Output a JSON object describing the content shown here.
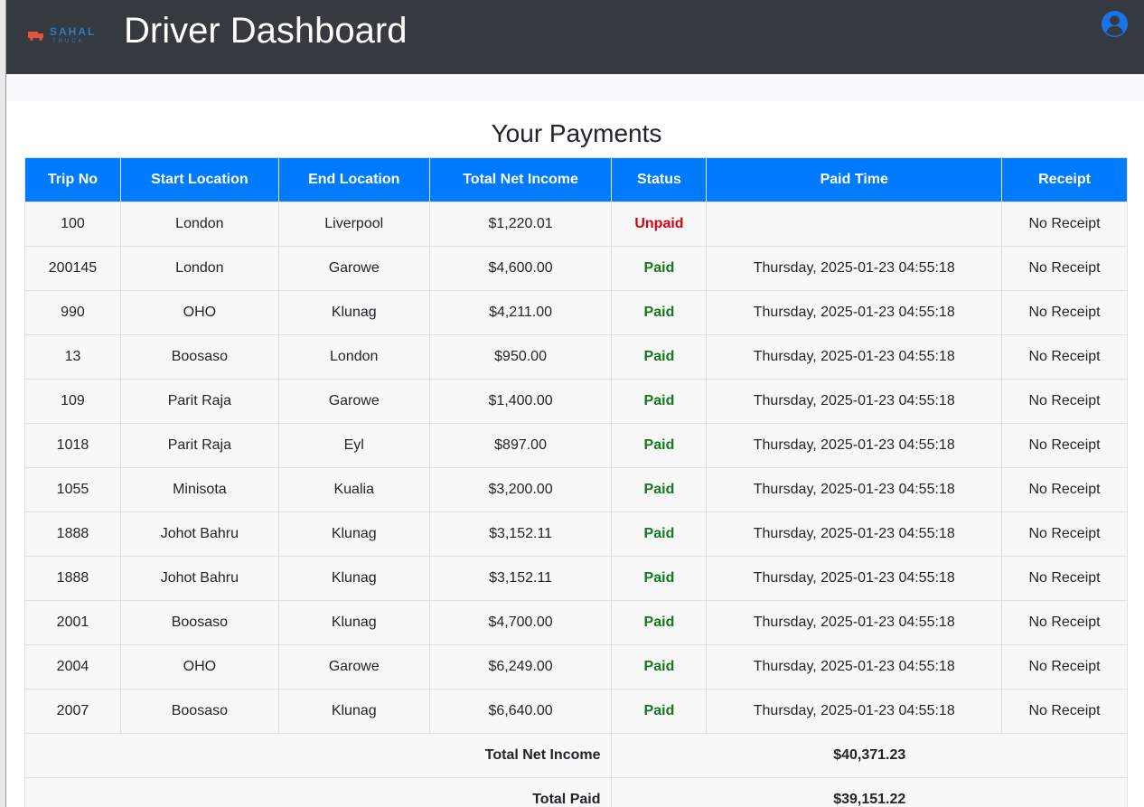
{
  "header": {
    "logo_text": "SAHAL",
    "logo_subtext": "TRUCK",
    "title": "Driver Dashboard"
  },
  "page": {
    "title": "Your Payments"
  },
  "table": {
    "columns": [
      "Trip No",
      "Start Location",
      "End Location",
      "Total Net Income",
      "Status",
      "Paid Time",
      "Receipt"
    ],
    "rows": [
      {
        "trip": "100",
        "start": "London",
        "end": "Liverpool",
        "income": "$1,220.01",
        "status": "Unpaid",
        "paid_time": "",
        "receipt": "No Receipt"
      },
      {
        "trip": "200145",
        "start": "London",
        "end": "Garowe",
        "income": "$4,600.00",
        "status": "Paid",
        "paid_time": "Thursday, 2025-01-23 04:55:18",
        "receipt": "No Receipt"
      },
      {
        "trip": "990",
        "start": "OHO",
        "end": "Klunag",
        "income": "$4,211.00",
        "status": "Paid",
        "paid_time": "Thursday, 2025-01-23 04:55:18",
        "receipt": "No Receipt"
      },
      {
        "trip": "13",
        "start": "Boosaso",
        "end": "London",
        "income": "$950.00",
        "status": "Paid",
        "paid_time": "Thursday, 2025-01-23 04:55:18",
        "receipt": "No Receipt"
      },
      {
        "trip": "109",
        "start": "Parit Raja",
        "end": "Garowe",
        "income": "$1,400.00",
        "status": "Paid",
        "paid_time": "Thursday, 2025-01-23 04:55:18",
        "receipt": "No Receipt"
      },
      {
        "trip": "1018",
        "start": "Parit Raja",
        "end": "Eyl",
        "income": "$897.00",
        "status": "Paid",
        "paid_time": "Thursday, 2025-01-23 04:55:18",
        "receipt": "No Receipt"
      },
      {
        "trip": "1055",
        "start": "Minisota",
        "end": "Kualia",
        "income": "$3,200.00",
        "status": "Paid",
        "paid_time": "Thursday, 2025-01-23 04:55:18",
        "receipt": "No Receipt"
      },
      {
        "trip": "1888",
        "start": "Johot Bahru",
        "end": "Klunag",
        "income": "$3,152.11",
        "status": "Paid",
        "paid_time": "Thursday, 2025-01-23 04:55:18",
        "receipt": "No Receipt"
      },
      {
        "trip": "1888",
        "start": "Johot Bahru",
        "end": "Klunag",
        "income": "$3,152.11",
        "status": "Paid",
        "paid_time": "Thursday, 2025-01-23 04:55:18",
        "receipt": "No Receipt"
      },
      {
        "trip": "2001",
        "start": "Boosaso",
        "end": "Klunag",
        "income": "$4,700.00",
        "status": "Paid",
        "paid_time": "Thursday, 2025-01-23 04:55:18",
        "receipt": "No Receipt"
      },
      {
        "trip": "2004",
        "start": "OHO",
        "end": "Garowe",
        "income": "$6,249.00",
        "status": "Paid",
        "paid_time": "Thursday, 2025-01-23 04:55:18",
        "receipt": "No Receipt"
      },
      {
        "trip": "2007",
        "start": "Boosaso",
        "end": "Klunag",
        "income": "$6,640.00",
        "status": "Paid",
        "paid_time": "Thursday, 2025-01-23 04:55:18",
        "receipt": "No Receipt"
      }
    ],
    "totals": [
      {
        "label": "Total Net Income",
        "value": "$40,371.23"
      },
      {
        "label": "Total Paid",
        "value": "$39,151.22"
      }
    ]
  },
  "colors": {
    "header_bg": "#343a40",
    "table_header_bg": "#007bff",
    "paid": "#117a1e",
    "unpaid": "#e0000f",
    "user_icon": "#1a73e8"
  },
  "icons": {
    "logo": "truck-icon",
    "user": "user-circle-icon"
  }
}
